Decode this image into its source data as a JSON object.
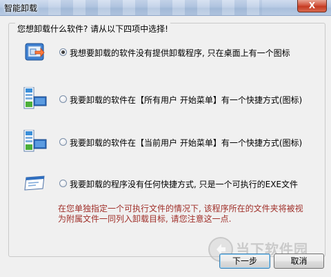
{
  "window": {
    "title": "智能卸载",
    "close_label": "X"
  },
  "group": {
    "prompt": "您想卸载什么软件? 请从以下四项中选择!"
  },
  "options": [
    {
      "label": "我想要卸载的软件没有提供卸载程序, 只在桌面上有一个图标",
      "icon": "desktop-shortcut-icon",
      "checked": true
    },
    {
      "label": "我要卸载的软件在【所有用户  开始菜单】有一个快捷方式(图标)",
      "icon": "start-menu-all-users-icon",
      "checked": false
    },
    {
      "label": "我要卸载的软件在【当前用户  开始菜单】有一个快捷方式(图标)",
      "icon": "start-menu-current-user-icon",
      "checked": false
    },
    {
      "label": "我要卸载的程序没有任何快捷方式, 只是一个可执行的EXE文件",
      "icon": "exe-file-icon",
      "checked": false
    }
  ],
  "note": "在您单独指定一个可执行文件的情况下, 该程序所在的文件夹将被视为附属文件一同列入卸载目标, 请您注意这一点.",
  "buttons": {
    "next": "下一步",
    "cancel": "取消"
  },
  "watermark": {
    "text": "当下软件园"
  },
  "colors": {
    "note_text": "#a0302a",
    "close_button": "#c43b22"
  }
}
